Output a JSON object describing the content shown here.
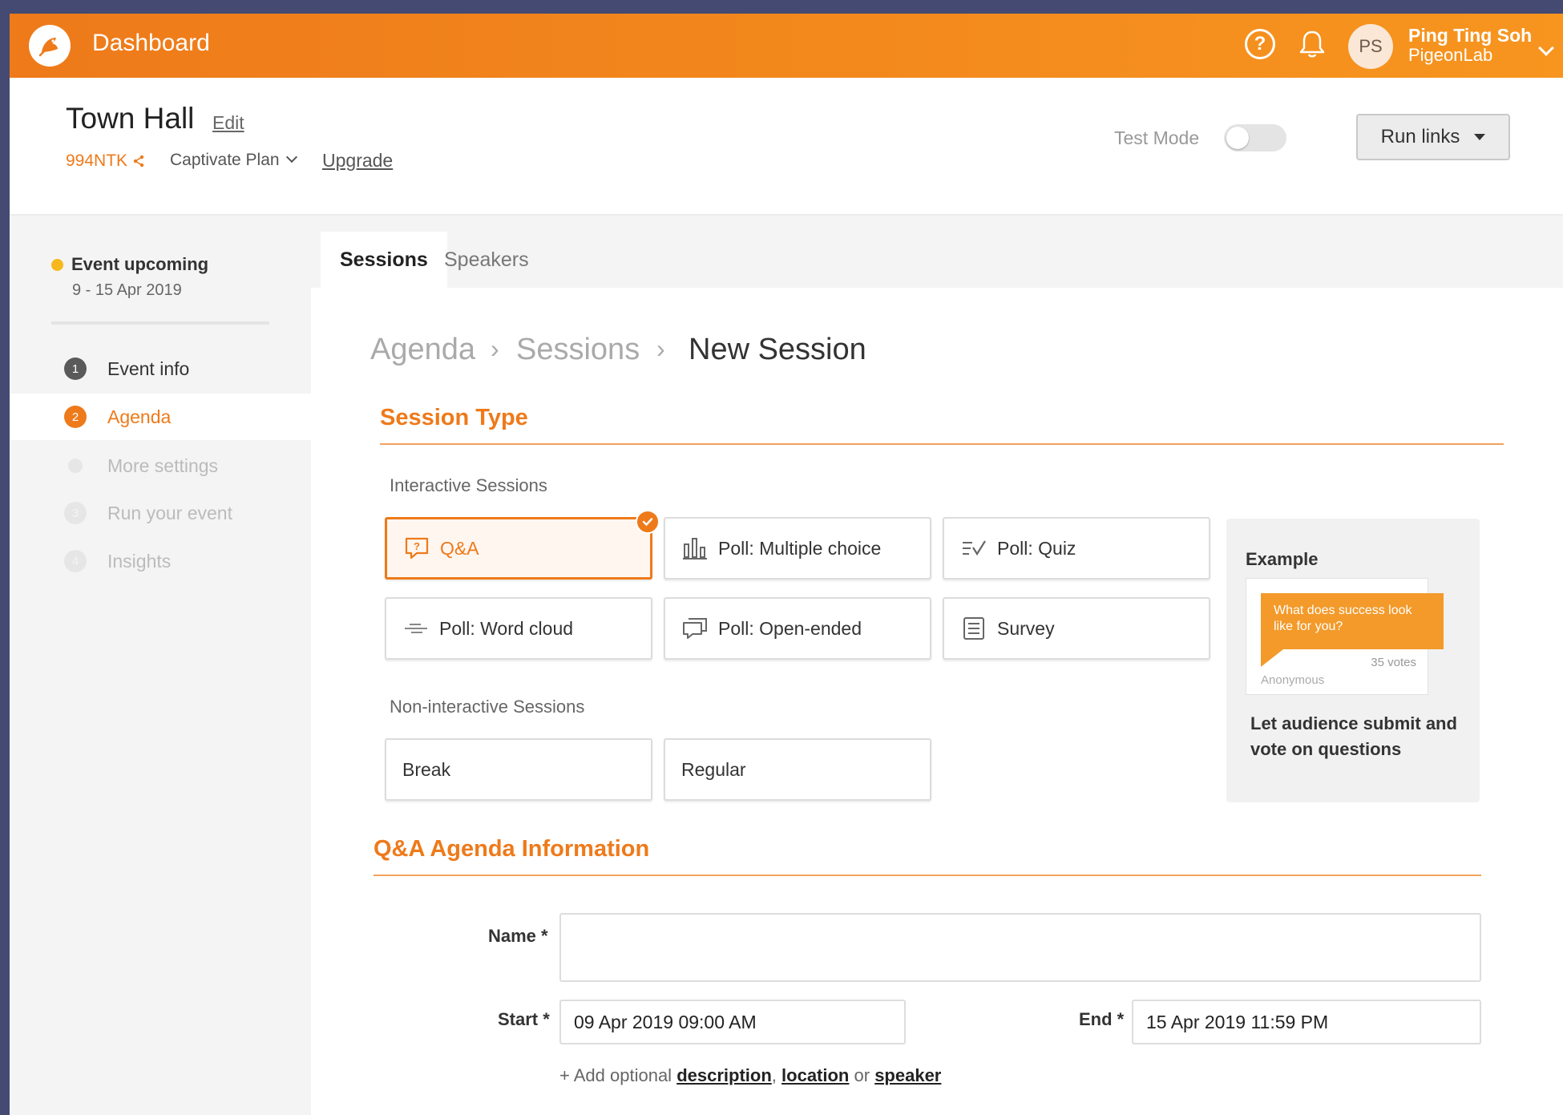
{
  "topbar": {
    "title": "Dashboard",
    "user": {
      "initials": "PS",
      "name": "Ping Ting Soh",
      "org": "PigeonLab"
    }
  },
  "event": {
    "title": "Town Hall",
    "edit_label": "Edit",
    "code": "994NTK",
    "plan": "Captivate Plan",
    "upgrade_label": "Upgrade",
    "test_mode_label": "Test Mode",
    "test_mode_on": false,
    "run_links_label": "Run links"
  },
  "sidebar": {
    "status": "Event upcoming",
    "dates": "9 - 15 Apr 2019",
    "steps": [
      {
        "num": "1",
        "label": "Event info"
      },
      {
        "num": "2",
        "label": "Agenda"
      },
      {
        "num": "",
        "label": "More settings"
      },
      {
        "num": "3",
        "label": "Run your event"
      },
      {
        "num": "4",
        "label": "Insights"
      }
    ]
  },
  "tabs": [
    {
      "label": "Sessions"
    },
    {
      "label": "Speakers"
    }
  ],
  "breadcrumb": [
    "Agenda",
    "Sessions",
    "New Session"
  ],
  "session_type": {
    "title": "Session Type",
    "interactive_label": "Interactive Sessions",
    "interactive": [
      {
        "label": "Q&A",
        "icon": "qa-icon",
        "selected": true
      },
      {
        "label": "Poll: Multiple choice",
        "icon": "bar-chart-icon"
      },
      {
        "label": "Poll: Quiz",
        "icon": "quiz-icon"
      },
      {
        "label": "Poll: Word cloud",
        "icon": "word-cloud-icon"
      },
      {
        "label": "Poll: Open-ended",
        "icon": "open-ended-icon"
      },
      {
        "label": "Survey",
        "icon": "survey-icon"
      }
    ],
    "noninteractive_label": "Non-interactive Sessions",
    "noninteractive": [
      {
        "label": "Break"
      },
      {
        "label": "Regular"
      }
    ],
    "example": {
      "title": "Example",
      "question": "What does success look like for you?",
      "votes": "35 votes",
      "author": "Anonymous",
      "description": "Let audience submit and vote on questions"
    }
  },
  "agenda_info": {
    "title": "Q&A Agenda Information",
    "name_label": "Name *",
    "name_value": "",
    "start_label": "Start *",
    "start_value": "09 Apr 2019 09:00 AM",
    "end_label": "End *",
    "end_value": "15 Apr 2019 11:59 PM",
    "add_optional_prefix": "+ Add optional",
    "link_description": "description",
    "sep_comma": ",",
    "link_location": "location",
    "sep_or": "or",
    "link_speaker": "speaker"
  },
  "colors": {
    "accent": "#ee7a1a",
    "sidebar_bg": "#f4f4f4",
    "frame_bg": "#444a72"
  }
}
